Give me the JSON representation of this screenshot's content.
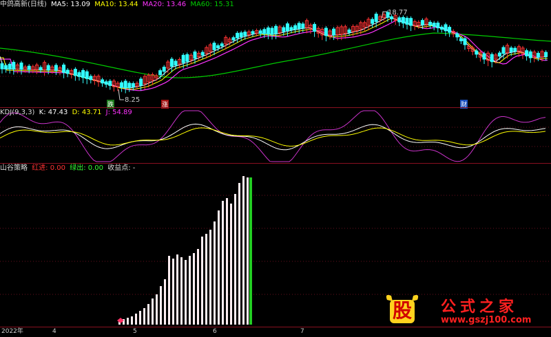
{
  "main_panel": {
    "title": "中鸽高新(日线)",
    "ma5_label": "MA5: 13.09",
    "ma10_label": "MA10: 13.44",
    "ma20_label": "MA20: 13.46",
    "ma60_label": "MA60: 15.31",
    "high_label": "18.77",
    "low_label": "8.25",
    "tag_die": "跌",
    "tag_zhang": "涨",
    "tag_cai": "财",
    "colors": {
      "ma5": "#ffffff",
      "ma10": "#ffff00",
      "ma20": "#ff33ff",
      "ma60": "#00cc00",
      "up": "#ff3333",
      "down": "#33ffff"
    }
  },
  "kdj_panel": {
    "title": "KDJ(9,3,3)",
    "k_label": "K: 47.43",
    "d_label": "D: 43.71",
    "j_label": "J: 54.89"
  },
  "strategy_panel": {
    "title": "山谷策略",
    "red_label": "红进: 0.00",
    "green_label": "绿出: 0.00",
    "profit_label": "收益点: -"
  },
  "x_axis": {
    "labels": [
      "2022年",
      "4",
      "5",
      "6",
      "7"
    ]
  },
  "watermark": {
    "logo_char": "股",
    "brand": "公式之家",
    "url": "www.gszj100.com"
  },
  "chart_data": [
    {
      "type": "line",
      "title": "中鸽高新(日线)",
      "series": [
        {
          "name": "MA5",
          "values": [
            13.09
          ]
        },
        {
          "name": "MA10",
          "values": [
            13.44
          ]
        },
        {
          "name": "MA20",
          "values": [
            13.46
          ]
        },
        {
          "name": "MA60",
          "values": [
            15.31
          ]
        }
      ],
      "annotations": [
        "18.77",
        "8.25"
      ]
    },
    {
      "type": "line",
      "title": "KDJ(9,3,3)",
      "series": [
        {
          "name": "K",
          "values": [
            47.43
          ]
        },
        {
          "name": "D",
          "values": [
            43.71
          ]
        },
        {
          "name": "J",
          "values": [
            54.89
          ]
        }
      ]
    },
    {
      "type": "bar",
      "title": "山谷策略",
      "series": [
        {
          "name": "红进",
          "values": [
            0.0
          ]
        },
        {
          "name": "绿出",
          "values": [
            0.0
          ]
        }
      ]
    }
  ]
}
